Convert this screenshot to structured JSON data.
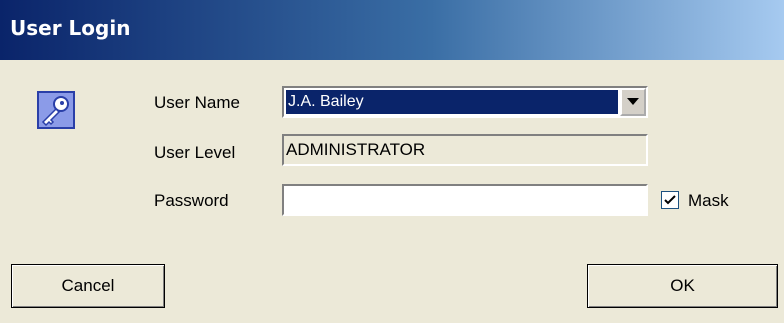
{
  "window": {
    "title": "User Login"
  },
  "form": {
    "user_name_label": "User Name",
    "user_name_value": "J.A. Bailey",
    "user_level_label": "User Level",
    "user_level_value": "ADMINISTRATOR",
    "password_label": "Password",
    "password_value": "",
    "mask_label": "Mask",
    "mask_checked": true
  },
  "buttons": {
    "cancel_label": "Cancel",
    "ok_label": "OK"
  },
  "icons": {
    "app_icon": "key-icon",
    "dropdown": "chevron-down-icon",
    "check": "checkmark-icon"
  },
  "colors": {
    "title_start": "#0A246A",
    "title_end": "#A6CAF0",
    "selection": "#0A246A",
    "face": "#ECE9D8"
  }
}
